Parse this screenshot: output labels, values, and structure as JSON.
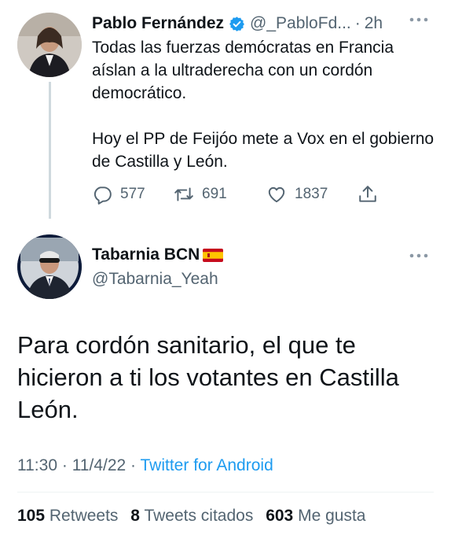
{
  "parent_tweet": {
    "author_name": "Pablo Fernández",
    "author_handle": "@_PabloFd...",
    "separator": "·",
    "time": "2h",
    "text_paragraphs": [
      "Todas las fuerzas demócratas en Francia aíslan a la ultraderecha con un cordón democrático.",
      "Hoy el PP de Feijóo mete a Vox en el gobierno de Castilla y León."
    ],
    "replies": "577",
    "retweets": "691",
    "likes": "1837"
  },
  "main_tweet": {
    "author_name": "Tabarnia BCN",
    "author_handle": "@Tabarnia_Yeah",
    "text": "Para cordón sanitario, el que te hicieron a ti los votantes en Castilla León.",
    "time": "11:30",
    "separator": "·",
    "date": "11/4/22",
    "source": "Twitter for Android",
    "stats": {
      "retweets_count": "105",
      "retweets_label": "Retweets",
      "quotes_count": "8",
      "quotes_label": "Tweets citados",
      "likes_count": "603",
      "likes_label": "Me gusta"
    }
  },
  "icons": {
    "more": "more-horizontal-icon",
    "verified": "verified-badge-icon",
    "reply": "reply-icon",
    "retweet": "retweet-icon",
    "like": "heart-icon",
    "share": "share-icon",
    "flag": "spain-flag-icon"
  },
  "colors": {
    "link": "#1d9bf0",
    "secondary_text": "#536471",
    "primary_text": "#0f1419",
    "verified": "#1d9bf0"
  }
}
